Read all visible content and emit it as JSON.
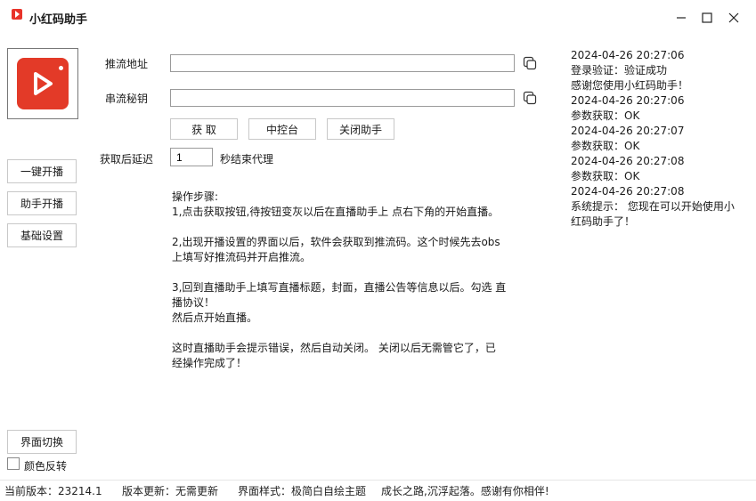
{
  "window": {
    "title": "小红码助手"
  },
  "sidebar": {
    "buttons": [
      "一键开播",
      "助手开播",
      "基础设置"
    ],
    "switch_label": "界面切换",
    "invert_label": "颜色反转"
  },
  "form": {
    "push_url_label": "推流地址",
    "push_url_value": "",
    "stream_key_label": "串流秘钥",
    "stream_key_value": "",
    "get_button": "获 取",
    "console_button": "中控台",
    "close_button": "关闭助手",
    "delay_label": "获取后延迟",
    "delay_value": "1",
    "delay_suffix": "秒结束代理"
  },
  "steps": {
    "heading": "操作步骤:",
    "step1": "1,点击获取按钮,待按钮变灰以后在直播助手上 点右下角的开始直播。",
    "step2a": "2,出现开播设置的界面以后，软件会获取到推流码。这个时候先去obs",
    "step2b": "上填写好推流码并开启推流。",
    "step3a": "3,回到直播助手上填写直播标题，封面，直播公告等信息以后。勾选 直",
    "step3b": "播协议！",
    "step3c": "然后点开始直播。",
    "note_a": "这时直播助手会提示错误，然后自动关闭。 关闭以后无需管它了，已",
    "note_b": "经操作完成了！"
  },
  "log": [
    "2024-04-26 20:27:06",
    "登录验证：验证成功",
    "感谢您使用小红码助手！",
    "2024-04-26 20:27:06",
    "参数获取：OK",
    "2024-04-26 20:27:07",
    "参数获取：OK",
    "2024-04-26 20:27:08",
    "参数获取：OK",
    "2024-04-26 20:27:08",
    "系统提示： 您现在可以开始使用小红码助手了！"
  ],
  "status": {
    "version": "当前版本：23214.1",
    "update": "版本更新：无需更新",
    "theme": "界面样式：极简白自绘主题",
    "slogan": "成长之路,沉浮起落。感谢有你相伴!"
  },
  "colors": {
    "brand": "#e33a28",
    "border": "#c8c8c8"
  }
}
